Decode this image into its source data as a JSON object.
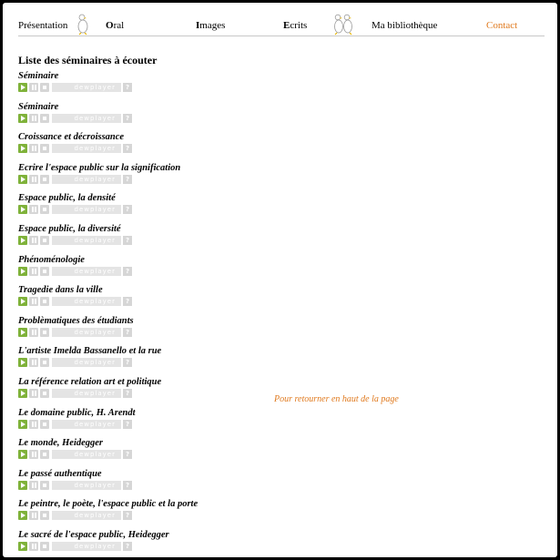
{
  "nav": {
    "items": [
      {
        "first": "",
        "rest": "Présentation"
      },
      {
        "first": "O",
        "rest": "ral"
      },
      {
        "first": "I",
        "rest": "mages"
      },
      {
        "first": "E",
        "rest": "crits"
      },
      {
        "first": "",
        "rest": "Ma bibliothèque"
      }
    ],
    "contact": "Contact"
  },
  "main": {
    "list_title": "Liste des séminaires à écouter",
    "player_label": "dewplayer",
    "player_help": "?",
    "items": [
      "Séminaire",
      "Séminaire",
      "Croissance et décroissance",
      "Ecrire l'espace public sur la signification",
      "Espace public, la densité",
      "Espace public, la diversité",
      "Phénoménologie",
      "Tragedie dans la ville",
      "Problèmatiques des étudiants",
      "L'artiste Imelda Bassanello et la rue",
      "La référence relation art et politique",
      "Le domaine public, H. Arendt",
      "Le monde, Heidegger",
      "Le passé authentique",
      "Le peintre, le poète, l'espace public et la porte",
      "Le sacré de l'espace public, Heidegger"
    ],
    "back_to_top": "Pour retourner en haut de la page"
  }
}
